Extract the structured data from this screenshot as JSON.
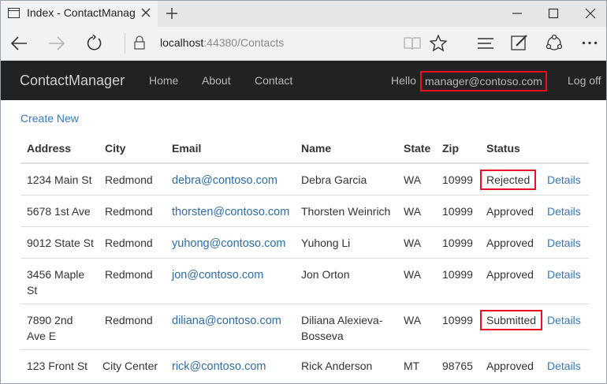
{
  "browser": {
    "tab_title": "Index - ContactManage",
    "url_host": "localhost",
    "url_rest": ":44380/Contacts"
  },
  "site": {
    "brand": "ContactManager",
    "nav": {
      "home": "Home",
      "about": "About",
      "contact": "Contact"
    },
    "hello": "Hello",
    "user_email": "manager@contoso.com",
    "logoff": "Log off"
  },
  "page": {
    "create_new": "Create New",
    "columns": [
      "Address",
      "City",
      "Email",
      "Name",
      "State",
      "Zip",
      "Status"
    ],
    "details_label": "Details",
    "rows": [
      {
        "address": "1234 Main St",
        "city": "Redmond",
        "email": "debra@contoso.com",
        "name": "Debra Garcia",
        "state": "WA",
        "zip": "10999",
        "status": "Rejected"
      },
      {
        "address": "5678 1st Ave",
        "city": "Redmond",
        "email": "thorsten@contoso.com",
        "name": "Thorsten Weinrich",
        "state": "WA",
        "zip": "10999",
        "status": "Approved"
      },
      {
        "address": "9012 State St",
        "city": "Redmond",
        "email": "yuhong@contoso.com",
        "name": "Yuhong Li",
        "state": "WA",
        "zip": "10999",
        "status": "Approved"
      },
      {
        "address": "3456 Maple St",
        "city": "Redmond",
        "email": "jon@contoso.com",
        "name": "Jon Orton",
        "state": "WA",
        "zip": "10999",
        "status": "Approved"
      },
      {
        "address": "7890 2nd Ave E",
        "city": "Redmond",
        "email": "diliana@contoso.com",
        "name": "Diliana Alexieva-Bosseva",
        "state": "WA",
        "zip": "10999",
        "status": "Submitted"
      },
      {
        "address": "123 Front St",
        "city": "City Center",
        "email": "rick@contoso.com",
        "name": "Rick Anderson",
        "state": "MT",
        "zip": "98765",
        "status": "Approved"
      }
    ]
  },
  "icons": {
    "tab_page": "page-icon",
    "tab_close": "close-icon",
    "new_tab": "plus-icon",
    "minimize": "minimize-icon",
    "maximize": "maximize-icon",
    "close": "close-icon",
    "back": "back-arrow-icon",
    "forward": "forward-arrow-icon",
    "refresh": "refresh-icon",
    "lock": "lock-icon",
    "reading_view": "book-icon",
    "favorite": "star-icon",
    "hub": "hub-icon",
    "web_note": "pen-icon",
    "share": "share-icon",
    "more": "more-icon"
  },
  "colors": {
    "navbar_bg": "#222222",
    "link": "#337ab7",
    "highlight": "#e81123"
  }
}
